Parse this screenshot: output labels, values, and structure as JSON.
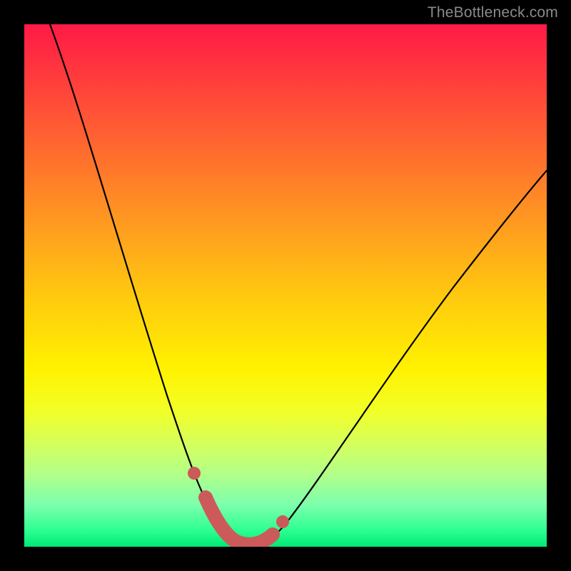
{
  "watermark": "TheBottleneck.com",
  "chart_data": {
    "type": "line",
    "title": "",
    "xlabel": "",
    "ylabel": "",
    "xlim": [
      0,
      100
    ],
    "ylim": [
      0,
      100
    ],
    "background_gradient": {
      "top": "#ff1a46",
      "mid": "#fff200",
      "bottom": "#00e876"
    },
    "series": [
      {
        "name": "bottleneck-curve",
        "color": "#000000",
        "x": [
          5,
          10,
          15,
          20,
          25,
          28,
          31,
          33,
          35,
          37,
          39,
          41,
          43,
          46,
          50,
          55,
          60,
          65,
          70,
          75,
          80,
          85,
          90,
          95,
          100
        ],
        "values": [
          100,
          86,
          73,
          60,
          45,
          34,
          24,
          16,
          10,
          6,
          3,
          1,
          0,
          0,
          2,
          7,
          14,
          22,
          30,
          37,
          43,
          49,
          55,
          60,
          64
        ]
      }
    ],
    "highlight": {
      "name": "optimal-range",
      "color": "#cc5a5a",
      "x": [
        33,
        35,
        37,
        39,
        41,
        43,
        46,
        48
      ],
      "values": [
        16,
        10,
        6,
        3,
        1,
        0,
        0,
        2
      ],
      "end_dots": true
    }
  }
}
